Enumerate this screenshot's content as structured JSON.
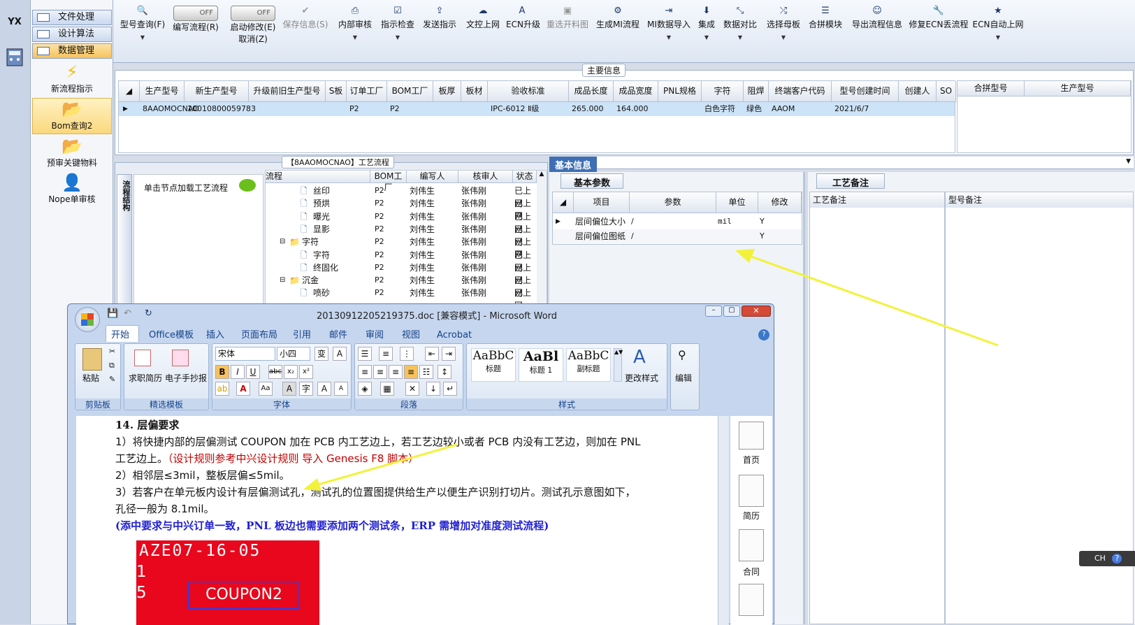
{
  "strip": {
    "logo": "YX",
    "icons": [
      "factory-icon",
      "calculator-icon"
    ]
  },
  "nav": {
    "buttons": [
      {
        "label": "文件处理"
      },
      {
        "label": "设计算法"
      },
      {
        "label": "数据管理"
      }
    ],
    "items": [
      {
        "label": "新流程指示",
        "icon": "lightning-icon"
      },
      {
        "label": "Bom查询2",
        "icon": "folder-icon"
      },
      {
        "label": "预审关键物料",
        "icon": "folder-icon"
      },
      {
        "label": "Nope单审核",
        "icon": "user-icon"
      }
    ]
  },
  "toolbar": {
    "items": [
      {
        "label": "型号查询(F)",
        "glyph": "🔍",
        "caret": true
      },
      {
        "label": "编写流程(R)",
        "toggle": "OFF"
      },
      {
        "label": "启动修改(E)",
        "toggle": "OFF",
        "sub": "取消(Z)"
      },
      {
        "label": "保存信息(S)",
        "glyph": "✔",
        "disabled": true
      },
      {
        "label": "内部审核",
        "glyph": "🖨",
        "caret": true
      },
      {
        "label": "指示检查",
        "glyph": "☑",
        "caret": true
      },
      {
        "label": "发送指示",
        "glyph": "⇪"
      },
      {
        "label": "文控上网",
        "glyph": "☁"
      },
      {
        "label": "ECN升级",
        "glyph": "A"
      },
      {
        "label": "重选开料图",
        "glyph": "▣",
        "disabled": true
      },
      {
        "label": "生成MI流程",
        "glyph": "⚙"
      },
      {
        "label": "MI数据导入",
        "glyph": "⇥",
        "caret": true
      },
      {
        "label": "集成",
        "glyph": "⬇",
        "caret": true
      },
      {
        "label": "数据对比",
        "glyph": "⤡",
        "caret": true
      },
      {
        "label": "选择母板",
        "glyph": "⤮",
        "caret": true
      },
      {
        "label": "合拼模块",
        "glyph": "☰"
      },
      {
        "label": "导出流程信息",
        "glyph": "☺"
      },
      {
        "label": "修复ECN丢流程",
        "glyph": "🔧"
      },
      {
        "label": "ECN自动上网",
        "glyph": "★",
        "caret": true
      }
    ]
  },
  "main_info": {
    "title": "主要信息",
    "columns": [
      "生产型号",
      "新生产型号",
      "升级前旧生产型号",
      "S板",
      "订单工厂",
      "BOM工厂",
      "板厚",
      "板材",
      "验收标准",
      "成品长度",
      "成品宽度",
      "PNL规格",
      "字符",
      "阻焊",
      "终端客户代码",
      "型号创建时间",
      "创建人",
      "SO"
    ],
    "row": [
      "8AAOMOCNAO",
      "10010800059783",
      "",
      "",
      "P2",
      "P2",
      "",
      "",
      "IPC-6012 Ⅱ级",
      "265.000",
      "164.000",
      "",
      "白色字符",
      "绿色",
      "AAOM",
      "2021/6/7",
      "",
      ""
    ],
    "side_columns": [
      "合拼型号",
      "生产型号"
    ]
  },
  "flow": {
    "title": "【8AAOMOCNAO】工艺流程",
    "vertical_tab": "流程结构",
    "hint": "单击节点加载工艺流程",
    "columns": [
      "流程",
      "BOM工厂",
      "编写人",
      "核审人",
      "状态"
    ],
    "rows": [
      {
        "name": "丝印",
        "level": 2,
        "folder": false,
        "bom": "P2",
        "writer": "刘伟生",
        "reviewer": "张伟刚",
        "status": "已上网"
      },
      {
        "name": "预烘",
        "level": 2,
        "folder": false,
        "bom": "P2",
        "writer": "刘伟生",
        "reviewer": "张伟刚",
        "status": "已上网"
      },
      {
        "name": "曝光",
        "level": 2,
        "folder": false,
        "bom": "P2",
        "writer": "刘伟生",
        "reviewer": "张伟刚",
        "status": "已上网"
      },
      {
        "name": "显影",
        "level": 2,
        "folder": false,
        "bom": "P2",
        "writer": "刘伟生",
        "reviewer": "张伟刚",
        "status": "已上网"
      },
      {
        "name": "字符",
        "level": 1,
        "folder": true,
        "bom": "P2",
        "writer": "刘伟生",
        "reviewer": "张伟刚",
        "status": "已上网"
      },
      {
        "name": "字符",
        "level": 2,
        "folder": false,
        "bom": "P2",
        "writer": "刘伟生",
        "reviewer": "张伟刚",
        "status": "已上网"
      },
      {
        "name": "终固化",
        "level": 2,
        "folder": false,
        "bom": "P2",
        "writer": "刘伟生",
        "reviewer": "张伟刚",
        "status": "已上网"
      },
      {
        "name": "沉金",
        "level": 1,
        "folder": true,
        "bom": "P2",
        "writer": "刘伟生",
        "reviewer": "张伟刚",
        "status": "已上网"
      },
      {
        "name": "喷砂",
        "level": 2,
        "folder": false,
        "bom": "P2",
        "writer": "刘伟生",
        "reviewer": "张伟刚",
        "status": "已上网"
      }
    ]
  },
  "basic_info": {
    "title": "基本信息",
    "tab": "基本参数",
    "columns": [
      "项目",
      "参数",
      "单位",
      "修改"
    ],
    "rows": [
      {
        "item": "层间偏位大小",
        "param": "/",
        "unit": "mil",
        "modify": "Y"
      },
      {
        "item": "层间偏位图纸",
        "param": "/",
        "unit": "",
        "modify": "Y"
      }
    ]
  },
  "process_notes": {
    "tab": "工艺备注",
    "columns": [
      "工艺备注",
      "型号备注"
    ]
  },
  "word": {
    "title": "20130912205219375.doc [兼容模式] - Microsoft Word",
    "tabs": [
      "开始",
      "Office模板",
      "插入",
      "页面布局",
      "引用",
      "邮件",
      "审阅",
      "视图",
      "Acrobat"
    ],
    "clipboard": {
      "paste": "粘贴",
      "label": "剪贴板"
    },
    "templates": {
      "items": [
        "求职简历",
        "电子手抄报"
      ],
      "label": "精选模板"
    },
    "font": {
      "name": "宋体",
      "size": "小四",
      "label": "字体"
    },
    "paragraph": {
      "label": "段落"
    },
    "styles": {
      "items": [
        {
          "sample": "AaBbC",
          "name": "标题"
        },
        {
          "sample": "AaBl",
          "name": "标题 1"
        },
        {
          "sample": "AaBbC",
          "name": "副标题"
        }
      ],
      "change": "更改样式",
      "label": "样式"
    },
    "edit": {
      "label": "编辑"
    },
    "doc": {
      "heading": "14. 层偏要求",
      "line1": "1）将快捷内部的层偏测试 COUPON  加在 PCB 内工艺边上，若工艺边较小或者 PCB 内没有工艺边，则加在 PNL",
      "line2a": "工艺边上。",
      "line2b": "（设计规则参考中兴设计规则 导入 Genesis F8 脚本）",
      "line3": "2）相邻层≤3mil，整板层偏≤5mil。",
      "line4": "3）若客户在单元板内设计有层偏测试孔，测试孔的位置图提供给生产以便生产识别打切片。测试孔示意图如下，",
      "line5": "孔径一般为 8.1mil。",
      "line6": "(添中要求与中兴订单一致，PNL 板边也需要添加两个测试条，ERP 需增加对准度测试流程)",
      "image_text1": "AZE07-16-05",
      "image_text2": "1",
      "image_text3": "5",
      "image_text4": "COUPON2"
    },
    "sidebar": [
      "首页",
      "简历",
      "合同"
    ]
  },
  "ime": {
    "label": "CH"
  },
  "colors": {
    "accent": "#15428b",
    "arrow": "#f2f23a",
    "selection": "#cde3f7",
    "red_text": "#c00000",
    "blue_text": "#1f1fd1"
  }
}
